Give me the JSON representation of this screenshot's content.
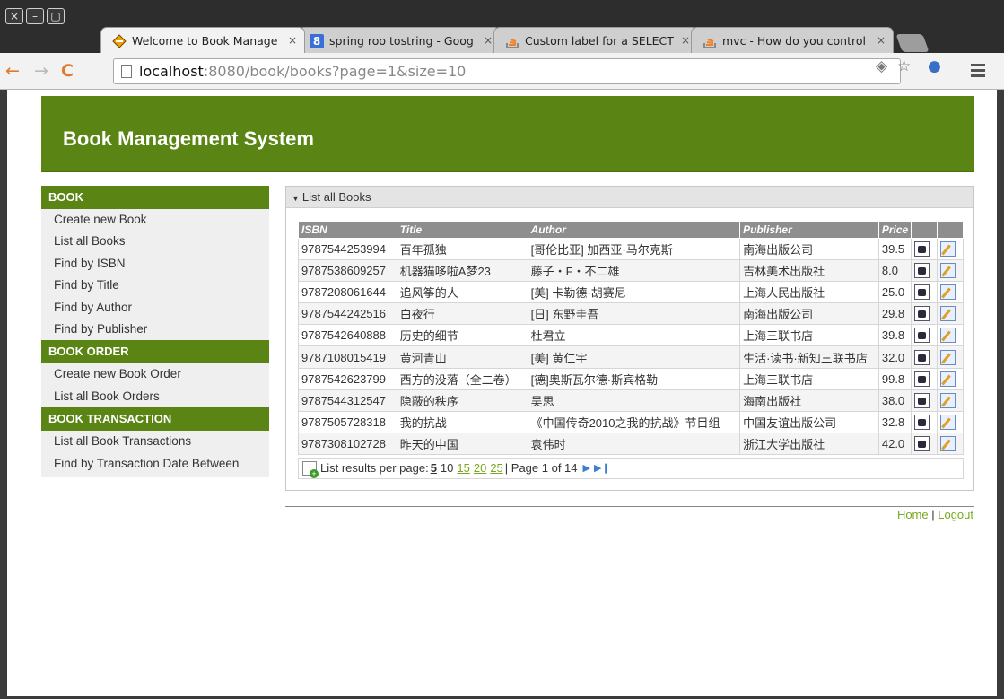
{
  "browser": {
    "window_buttons": [
      "×",
      "–",
      "▢"
    ],
    "tabs": [
      {
        "label": "Welcome to Book Manage",
        "icon": "book-diamond-icon",
        "close": "×",
        "active": true
      },
      {
        "label": "spring roo tostring - Goog",
        "icon": "google-icon",
        "close": "×",
        "active": false
      },
      {
        "label": "Custom label for a SELECT",
        "icon": "stack-overflow-icon",
        "close": "×",
        "active": false
      },
      {
        "label": "mvc - How do you control",
        "icon": "stack-overflow-icon",
        "close": "×",
        "active": false
      }
    ],
    "url_host": "localhost",
    "url_rest": ":8080/book/books?page=1&size=10"
  },
  "header": {
    "title": "Book Management System"
  },
  "sidebar": {
    "sections": [
      {
        "title": "BOOK",
        "items": [
          "Create new Book",
          "List all Books",
          "Find by ISBN",
          "Find by Title",
          "Find by Author",
          "Find by Publisher"
        ]
      },
      {
        "title": "BOOK ORDER",
        "items": [
          "Create new Book Order",
          "List all Book Orders"
        ]
      },
      {
        "title": "BOOK TRANSACTION",
        "items": [
          "List all Book Transactions",
          "Find by Transaction Date Between"
        ]
      }
    ]
  },
  "panel": {
    "title": "List all Books"
  },
  "table": {
    "columns": [
      "ISBN",
      "Title",
      "Author",
      "Publisher",
      "Price"
    ],
    "rows": [
      [
        "9787544253994",
        "百年孤独",
        "[哥伦比亚] 加西亚·马尔克斯",
        "南海出版公司",
        "39.5"
      ],
      [
        "9787538609257",
        "机器猫哆啦A梦23",
        "藤子・F・不二雄",
        "吉林美术出版社",
        "8.0"
      ],
      [
        "9787208061644",
        "追风筝的人",
        "[美] 卡勒德·胡赛尼",
        "上海人民出版社",
        "25.0"
      ],
      [
        "9787544242516",
        "白夜行",
        "[日] 东野圭吾",
        "南海出版公司",
        "29.8"
      ],
      [
        "9787542640888",
        "历史的细节",
        "杜君立",
        "上海三联书店",
        "39.8"
      ],
      [
        "9787108015419",
        "黄河青山",
        "[美] 黄仁宇",
        "生活·读书·新知三联书店",
        "32.0"
      ],
      [
        "9787542623799",
        "西方的没落（全二卷）",
        "[德]奥斯瓦尔德·斯宾格勒",
        "上海三联书店",
        "99.8"
      ],
      [
        "9787544312547",
        "隐蔽的秩序",
        "吴思",
        "海南出版社",
        "38.0"
      ],
      [
        "9787505728318",
        "我的抗战",
        "《中国传奇2010之我的抗战》节目组",
        "中国友谊出版公司",
        "32.8"
      ],
      [
        "9787308102728",
        "昨天的中国",
        "袁伟时",
        "浙江大学出版社",
        "42.0"
      ]
    ]
  },
  "pager": {
    "label": "List results per page:",
    "current": "5",
    "plain": "10",
    "links": [
      "15",
      "20",
      "25"
    ],
    "sep": "|",
    "status": "| Page 1 of 14"
  },
  "footer": {
    "home": "Home",
    "sep": " | ",
    "logout": "Logout"
  }
}
